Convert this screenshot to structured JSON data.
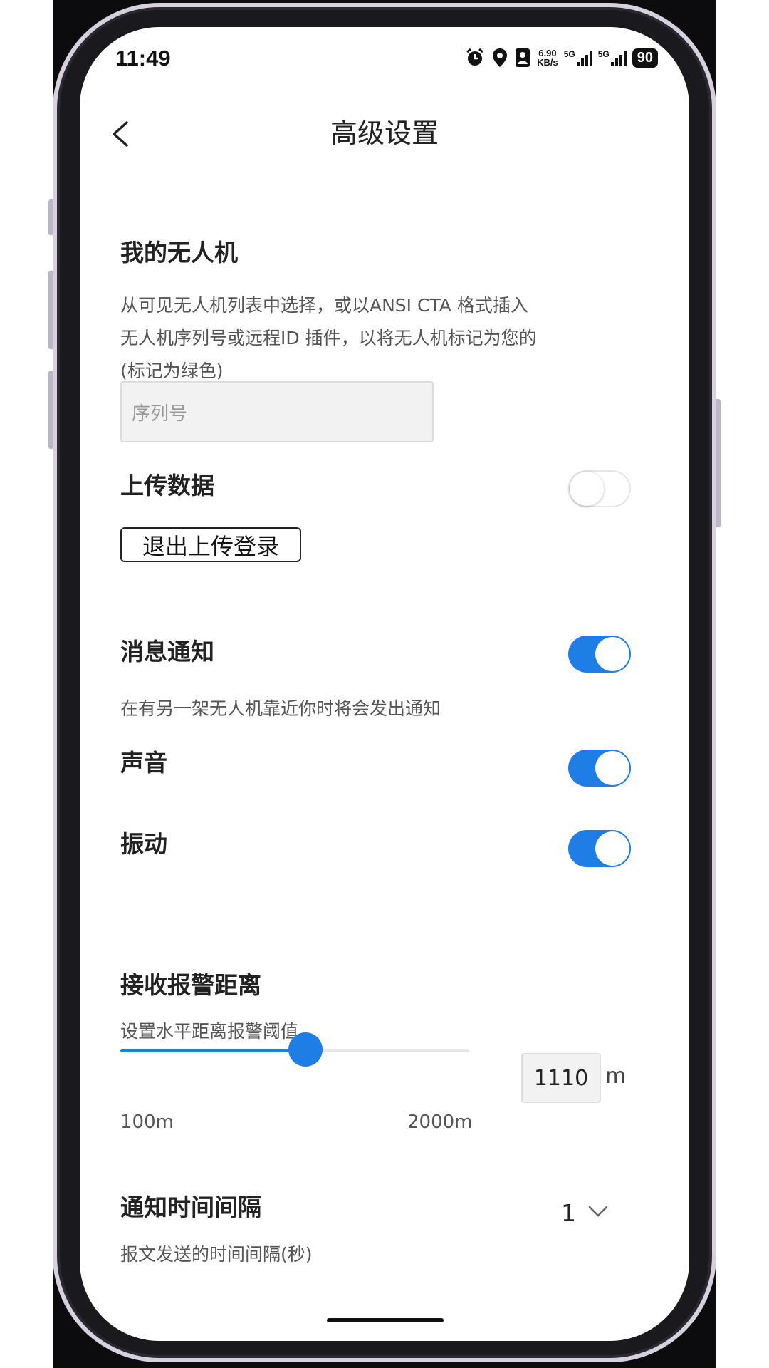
{
  "status_bar": {
    "time": "11:49",
    "speed_value": "6.90",
    "speed_unit": "KB/s",
    "net1": "5G",
    "net2": "5G",
    "battery": "90",
    "icons": [
      "alarm-icon",
      "location-icon",
      "contact-card-icon",
      "signal-icon",
      "signal-icon"
    ]
  },
  "header": {
    "title": "高级设置",
    "back_icon": "chevron-left-icon"
  },
  "my_drone": {
    "title": "我的无人机",
    "description_lines": [
      "从可见无人机列表中选择，或以ANSI CTA 格式插入",
      "无人机序列号或远程ID 插件，以将无人机标记为您的",
      "(标记为绿色)"
    ],
    "serial_placeholder": "序列号"
  },
  "upload": {
    "title": "上传数据",
    "enabled": false,
    "logout_label": "退出上传登录"
  },
  "notifications": {
    "title": "消息通知",
    "enabled": true,
    "description": "在有另一架无人机靠近你时将会发出通知",
    "sound_label": "声音",
    "sound_enabled": true,
    "vibration_label": "振动",
    "vibration_enabled": true
  },
  "alert_distance": {
    "title": "接收报警距离",
    "description": "设置水平距离报警阈值",
    "min_label": "100m",
    "max_label": "2000m",
    "min": 100,
    "max": 2000,
    "value": 1110,
    "value_text": "1110",
    "unit": "m"
  },
  "interval": {
    "title": "通知时间间隔",
    "description": "报文发送的时间间隔(秒)",
    "selected": "1"
  },
  "colors": {
    "accent": "#1f7ee6",
    "frame": "#d7d1de"
  }
}
